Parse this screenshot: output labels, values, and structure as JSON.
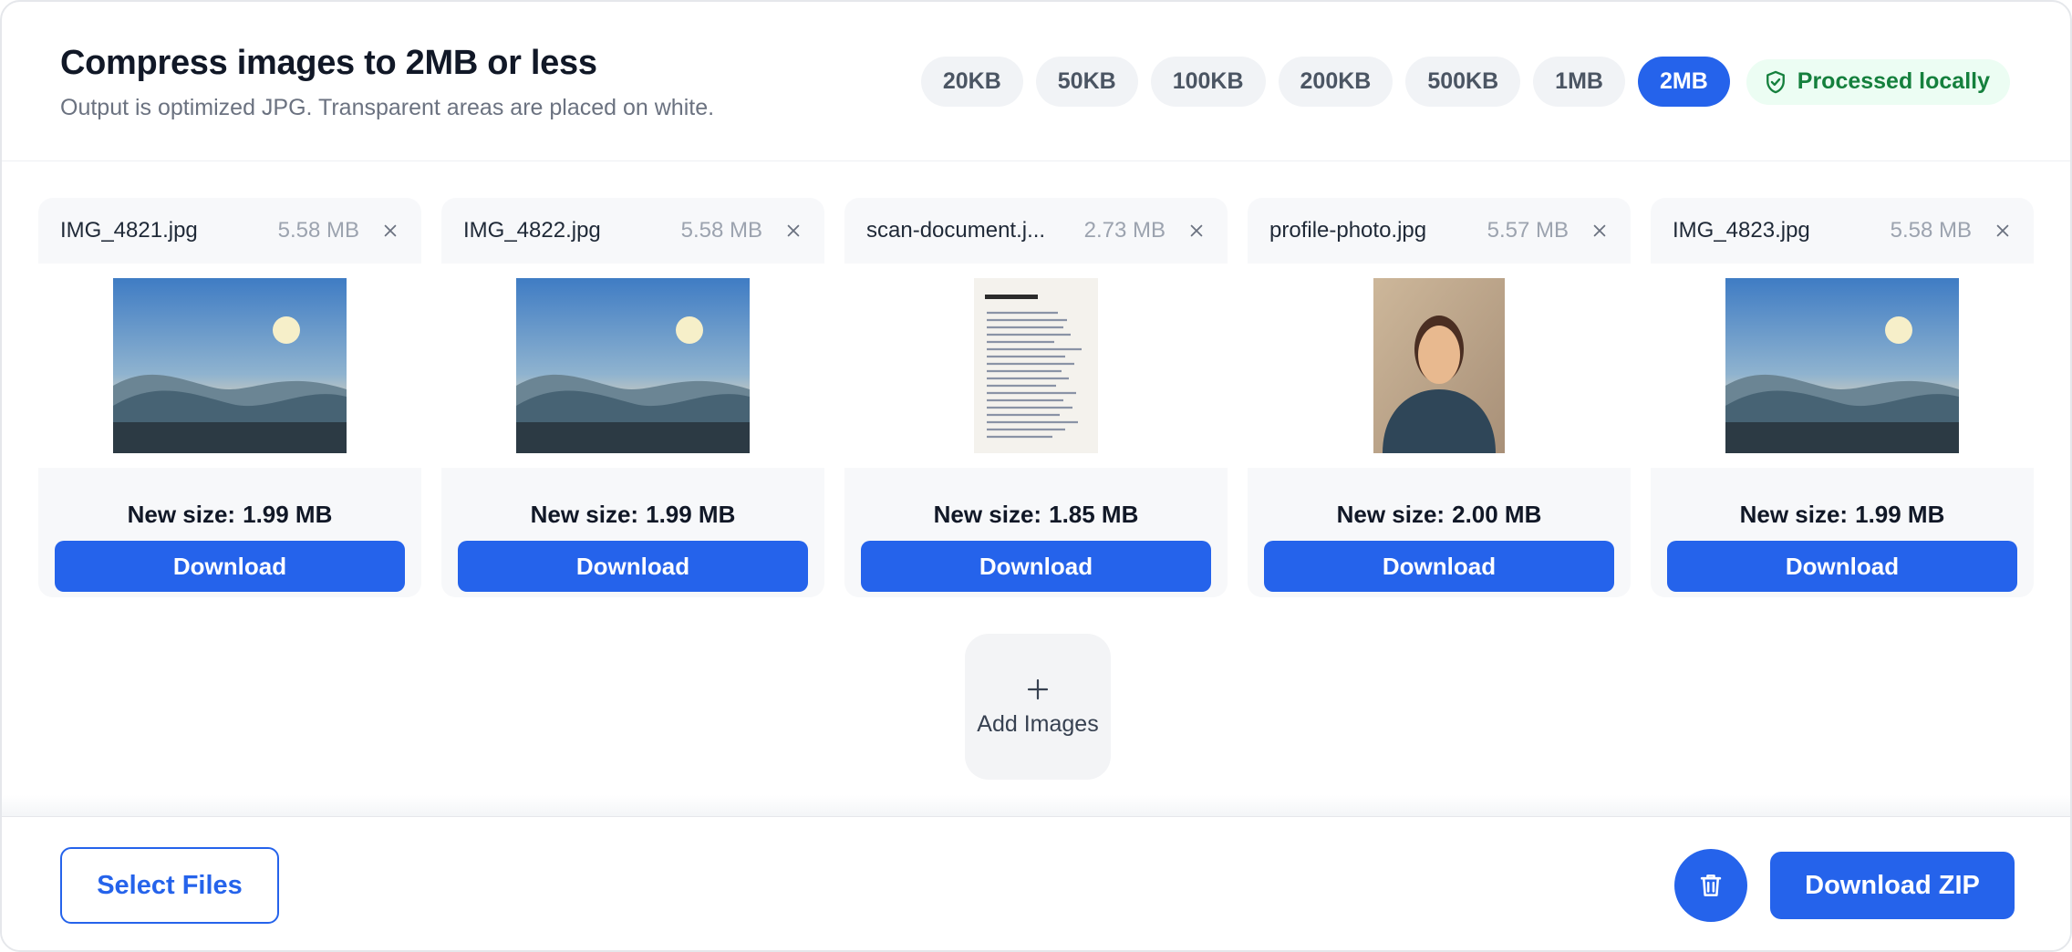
{
  "header": {
    "title": "Compress images to 2MB or less",
    "subtitle": "Output is optimized JPG. Transparent areas are placed on white.",
    "presets": [
      "20KB",
      "50KB",
      "100KB",
      "200KB",
      "500KB",
      "1MB",
      "2MB"
    ],
    "active_preset": "2MB",
    "local_badge": "Processed locally"
  },
  "files": [
    {
      "name": "IMG_4821.jpg",
      "size": "5.58 MB",
      "new_size_label": "New size:",
      "new_size": "1.99 MB",
      "download_label": "Download",
      "thumb": "landscape"
    },
    {
      "name": "IMG_4822.jpg",
      "size": "5.58 MB",
      "new_size_label": "New size:",
      "new_size": "1.99 MB",
      "download_label": "Download",
      "thumb": "landscape"
    },
    {
      "name": "scan-document.j...",
      "size": "2.73 MB",
      "new_size_label": "New size:",
      "new_size": "1.85 MB",
      "download_label": "Download",
      "thumb": "document"
    },
    {
      "name": "profile-photo.jpg",
      "size": "5.57 MB",
      "new_size_label": "New size:",
      "new_size": "2.00 MB",
      "download_label": "Download",
      "thumb": "portrait"
    },
    {
      "name": "IMG_4823.jpg",
      "size": "5.58 MB",
      "new_size_label": "New size:",
      "new_size": "1.99 MB",
      "download_label": "Download",
      "thumb": "landscape"
    }
  ],
  "add_images": {
    "label": "Add Images",
    "icon": "plus-icon"
  },
  "footer": {
    "select_files": "Select Files",
    "download_zip": "Download ZIP",
    "clear_icon": "trash-icon"
  },
  "colors": {
    "accent": "#2563eb",
    "success": "#15803d",
    "success_bg": "#ecfdf3"
  }
}
